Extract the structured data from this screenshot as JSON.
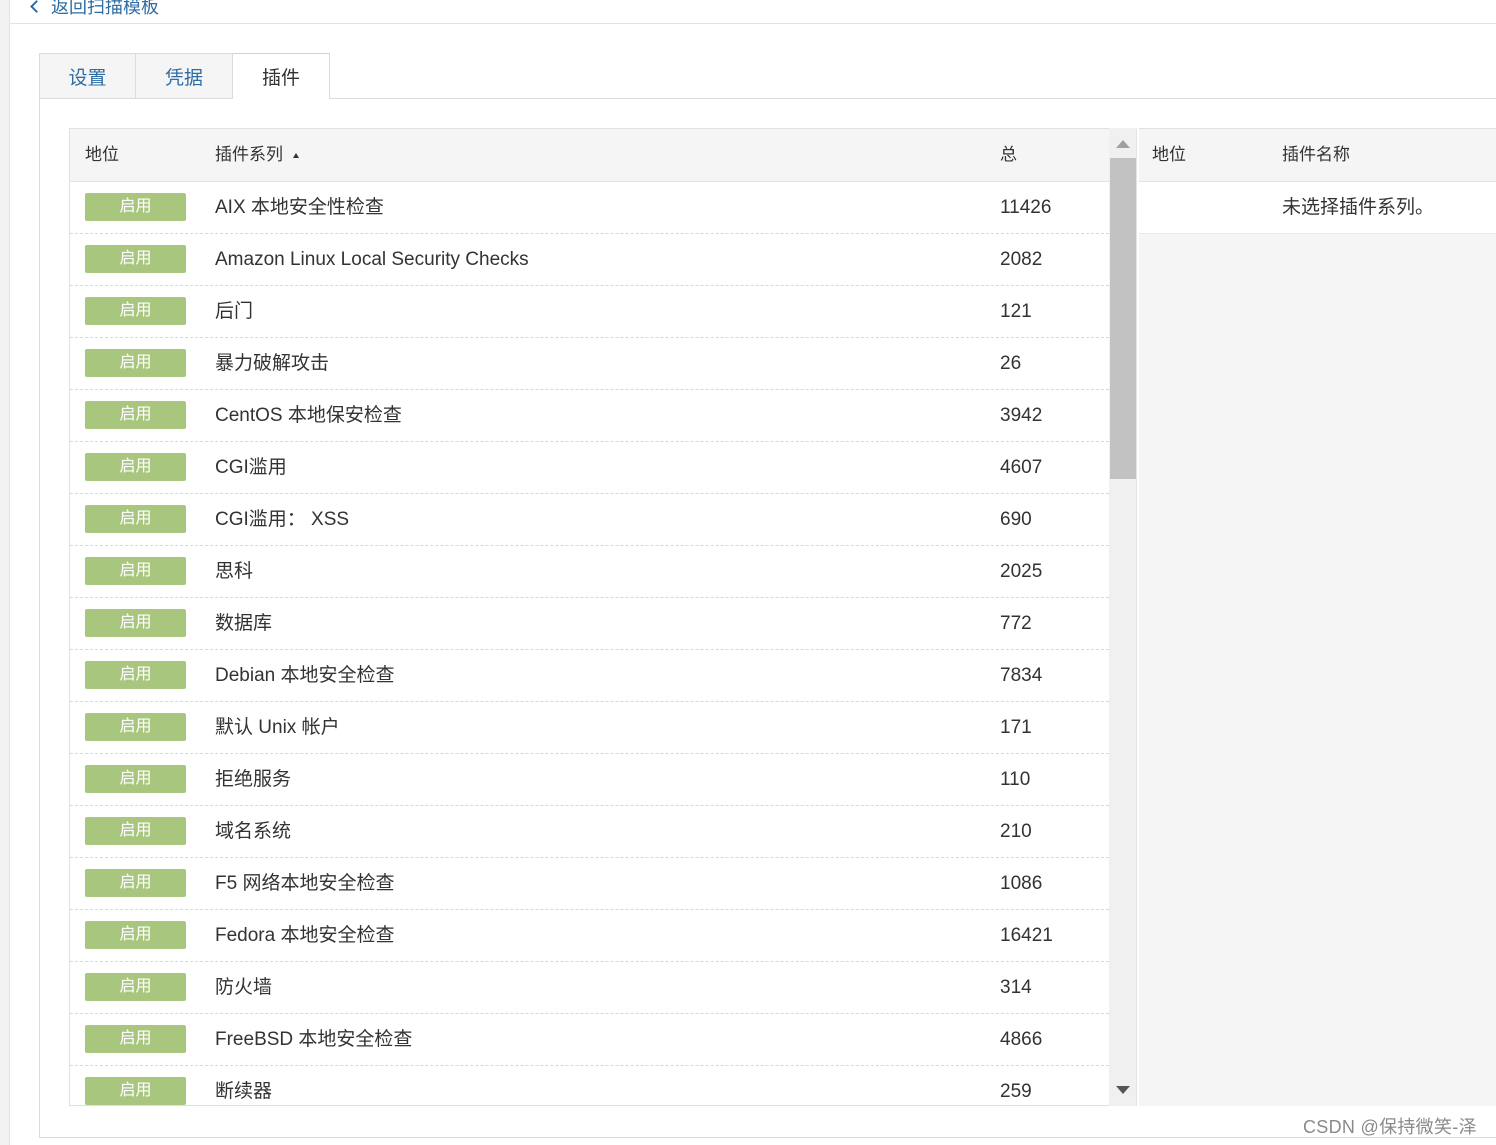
{
  "nav": {
    "back_label": "返回扫描模板"
  },
  "tabs": [
    {
      "label": "设置",
      "active": false
    },
    {
      "label": "凭据",
      "active": false
    },
    {
      "label": "插件",
      "active": true
    }
  ],
  "families_table": {
    "headers": {
      "status": "地位",
      "family": "插件系列",
      "total": "总"
    },
    "sort": {
      "column": "family",
      "direction": "ascending"
    },
    "rows": [
      {
        "status": "启用",
        "name": "AIX 本地安全性检查",
        "total": "11426"
      },
      {
        "status": "启用",
        "name": "Amazon Linux Local Security Checks",
        "total": "2082"
      },
      {
        "status": "启用",
        "name": "后门",
        "total": "121"
      },
      {
        "status": "启用",
        "name": "暴力破解攻击",
        "total": "26"
      },
      {
        "status": "启用",
        "name": "CentOS 本地保安检查",
        "total": "3942"
      },
      {
        "status": "启用",
        "name": "CGI滥用",
        "total": "4607"
      },
      {
        "status": "启用",
        "name": "CGI滥用：  XSS",
        "total": "690"
      },
      {
        "status": "启用",
        "name": "思科",
        "total": "2025"
      },
      {
        "status": "启用",
        "name": "数据库",
        "total": "772"
      },
      {
        "status": "启用",
        "name": "Debian 本地安全检查",
        "total": "7834"
      },
      {
        "status": "启用",
        "name": "默认 Unix 帐户",
        "total": "171"
      },
      {
        "status": "启用",
        "name": "拒绝服务",
        "total": "110"
      },
      {
        "status": "启用",
        "name": "域名系统",
        "total": "210"
      },
      {
        "status": "启用",
        "name": "F5 网络本地安全检查",
        "total": "1086"
      },
      {
        "status": "启用",
        "name": "Fedora 本地安全检查",
        "total": "16421"
      },
      {
        "status": "启用",
        "name": "防火墙",
        "total": "314"
      },
      {
        "status": "启用",
        "name": "FreeBSD 本地安全检查",
        "total": "4866"
      },
      {
        "status": "启用",
        "name": "断续器",
        "total": "259"
      }
    ]
  },
  "plugins_table": {
    "headers": {
      "status": "地位",
      "name": "插件名称"
    },
    "empty_message": "未选择插件系列。"
  },
  "watermark": "CSDN @保持微笑-泽",
  "colors": {
    "enabled_badge": "#a9c67e",
    "link": "#2e6da4"
  },
  "icons": {
    "back": "chevron-left-icon",
    "sort": "sort-ascending-icon",
    "scroll_up": "arrow-up-icon",
    "scroll_down": "arrow-down-icon"
  }
}
